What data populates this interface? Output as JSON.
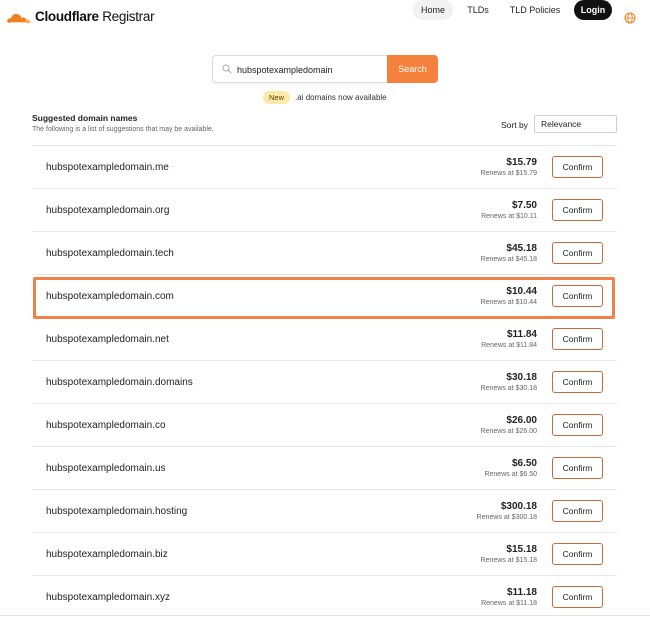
{
  "header": {
    "brand_bold": "Cloudflare",
    "brand_regular": " Registrar",
    "nav": {
      "home": "Home",
      "tlds": "TLDs",
      "policies": "TLD Policies",
      "login": "Login"
    },
    "globe_icon": "globe-icon",
    "logo_icon": "cloudflare-cloud-logo",
    "brand_color": "#f38020"
  },
  "search": {
    "value": "hubspotexampledomain",
    "button_label": "Search",
    "button_color": "#f6813d"
  },
  "announcement": {
    "badge": "New",
    "text": ".ai domains now available"
  },
  "suggestions": {
    "title": "Suggested domain names",
    "subtitle": "The following is a list of suggestions that may be available.",
    "sort_label": "Sort by",
    "sort_value": "Relevance",
    "rows": [
      {
        "domain": "hubspotexampledomain.me",
        "price": "$15.79",
        "renews": "Renews at $15.79",
        "action": "Confirm"
      },
      {
        "domain": "hubspotexampledomain.org",
        "price": "$7.50",
        "renews": "Renews at $10.11",
        "action": "Confirm"
      },
      {
        "domain": "hubspotexampledomain.tech",
        "price": "$45.18",
        "renews": "Renews at $45.18",
        "action": "Confirm"
      },
      {
        "domain": "hubspotexampledomain.com",
        "price": "$10.44",
        "renews": "Renews at $10.44",
        "action": "Confirm"
      },
      {
        "domain": "hubspotexampledomain.net",
        "price": "$11.84",
        "renews": "Renews at $11.84",
        "action": "Confirm"
      },
      {
        "domain": "hubspotexampledomain.domains",
        "price": "$30.18",
        "renews": "Renews at $30.18",
        "action": "Confirm"
      },
      {
        "domain": "hubspotexampledomain.co",
        "price": "$26.00",
        "renews": "Renews at $26.00",
        "action": "Confirm"
      },
      {
        "domain": "hubspotexampledomain.us",
        "price": "$6.50",
        "renews": "Renews at $6.50",
        "action": "Confirm"
      },
      {
        "domain": "hubspotexampledomain.hosting",
        "price": "$300.18",
        "renews": "Renews at $300.18",
        "action": "Confirm"
      },
      {
        "domain": "hubspotexampledomain.biz",
        "price": "$15.18",
        "renews": "Renews at $15.18",
        "action": "Confirm"
      },
      {
        "domain": "hubspotexampledomain.xyz",
        "price": "$11.18",
        "renews": "Renews at $11.18",
        "action": "Confirm"
      }
    ]
  },
  "highlight_color": "#ee8248"
}
